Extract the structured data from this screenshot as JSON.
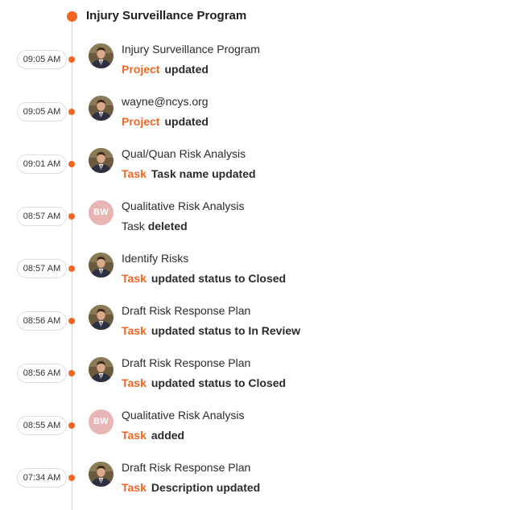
{
  "header": {
    "title": "Injury Surveillance Program"
  },
  "colors": {
    "accent": "#f26522",
    "avatar_initials_bg": "#e8b5b5",
    "timeline_line": "#d6d6d6"
  },
  "entries": [
    {
      "time": "09:05 AM",
      "avatar": "photo",
      "name": "Injury Surveillance Program",
      "kind": "Project",
      "action": "updated"
    },
    {
      "time": "09:05 AM",
      "avatar": "photo",
      "name": "wayne@ncys.org",
      "kind": "Project",
      "action": "updated"
    },
    {
      "time": "09:01 AM",
      "avatar": "photo",
      "name": "Qual/Quan Risk Analysis",
      "kind": "Task",
      "action": "Task name updated"
    },
    {
      "time": "08:57 AM",
      "avatar": "initials",
      "initials": "BW",
      "name": "Qualitative Risk Analysis",
      "prefix": "Task",
      "action": "deleted"
    },
    {
      "time": "08:57 AM",
      "avatar": "photo",
      "name": "Identify Risks",
      "kind": "Task",
      "action": "updated status to Closed"
    },
    {
      "time": "08:56 AM",
      "avatar": "photo",
      "name": "Draft Risk Response Plan",
      "kind": "Task",
      "action": "updated status to In Review"
    },
    {
      "time": "08:56 AM",
      "avatar": "photo",
      "name": "Draft Risk Response Plan",
      "kind": "Task",
      "action": "updated status to Closed"
    },
    {
      "time": "08:55 AM",
      "avatar": "initials",
      "initials": "BW",
      "name": "Qualitative Risk Analysis",
      "kind": "Task",
      "action": "added"
    },
    {
      "time": "07:34 AM",
      "avatar": "photo",
      "name": "Draft Risk Response Plan",
      "kind": "Task",
      "action": "Description updated"
    }
  ]
}
